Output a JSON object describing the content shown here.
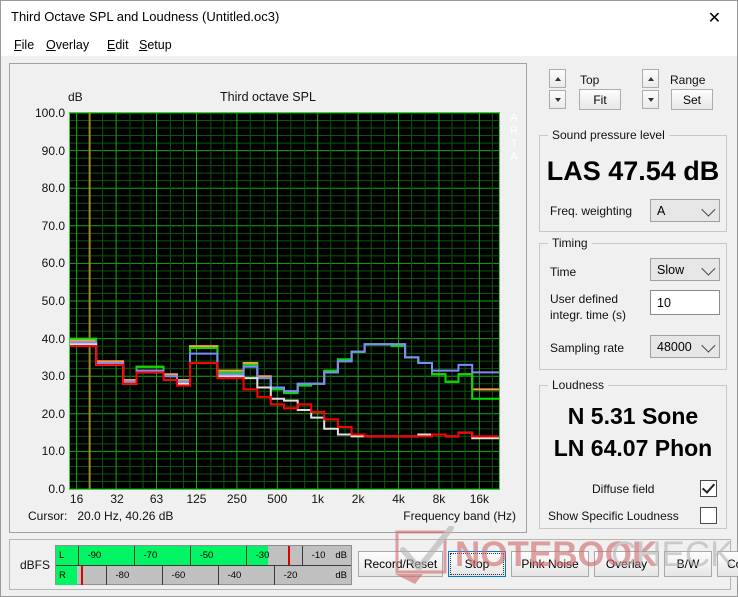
{
  "window": {
    "title": "Third Octave SPL and Loudness (Untitled.oc3)",
    "close_icon": "close-icon"
  },
  "menu": [
    {
      "label": "File",
      "accel": "F"
    },
    {
      "label": "Overlay",
      "accel": "O"
    },
    {
      "label": "Edit",
      "accel": "E"
    },
    {
      "label": "Setup",
      "accel": "S"
    }
  ],
  "chart_panel": {
    "title": "Third octave SPL",
    "y_unit": "dB",
    "watermark_vertical": "ARTA",
    "cursor_label": "Cursor:",
    "cursor_value": "20.0 Hz, 40.26 dB",
    "x_axis_title": "Frequency band (Hz)"
  },
  "toolbar": {
    "top_label": "Top",
    "top_button": "Fit",
    "range_label": "Range",
    "range_button": "Set"
  },
  "spl": {
    "group_title": "Sound pressure level",
    "value": "LAS 47.54 dB",
    "weighting_label": "Freq. weighting",
    "weighting_value": "A"
  },
  "timing": {
    "group_title": "Timing",
    "time_label": "Time",
    "time_value": "Slow",
    "integr_label_1": "User defined",
    "integr_label_2": "integr. time (s)",
    "integr_value": "10",
    "sampling_label": "Sampling rate",
    "sampling_value": "48000"
  },
  "loudness": {
    "group_title": "Loudness",
    "sone": "N 5.31 Sone",
    "phon": "LN 64.07 Phon",
    "diffuse_label": "Diffuse field",
    "diffuse_checked": true,
    "specific_label": "Show Specific Loudness",
    "specific_checked": false
  },
  "meter": {
    "label": "dBFS",
    "left_channel": "L",
    "right_channel": "R",
    "unit_left": "dB",
    "unit_right": "dB",
    "top_ticks": [
      "-90",
      "-70",
      "-50",
      "-30",
      "-10"
    ],
    "bottom_ticks": [
      "-80",
      "-60",
      "-40",
      "-20"
    ],
    "left_level_pct": 72,
    "right_level_pct": 7
  },
  "buttons": [
    {
      "label": "Record/Reset",
      "focused": false
    },
    {
      "label": "Stop",
      "focused": true
    },
    {
      "label": "Pink Noise",
      "focused": false
    },
    {
      "label": "Overlay",
      "focused": false
    },
    {
      "label": "B/W",
      "focused": false
    },
    {
      "label": "Copy",
      "focused": false
    }
  ],
  "watermark": {
    "text_red": "NOTEBOOK",
    "text_gray": "CHECK"
  },
  "colors": {
    "plot_bg": "#000000",
    "grid_major": "#19a519",
    "grid_minor": "#0d550d",
    "plot_border": "#39d339",
    "cursor_line": "#9a8a22",
    "curve_orange": "#ff9b45",
    "curve_green": "#00e000",
    "curve_blue": "#7a8cff",
    "curve_white": "#e0e0e0",
    "curve_red": "#ff0000",
    "meter_green": "#00f464",
    "brand_red": "#cf6b6b"
  },
  "chart_data": {
    "type": "line",
    "title": "Third octave SPL",
    "xlabel": "Frequency band (Hz)",
    "ylabel": "dB",
    "ylim": [
      0.0,
      100.0
    ],
    "ytick_labels": [
      "100.0",
      "90.0",
      "80.0",
      "70.0",
      "60.0",
      "50.0",
      "40.0",
      "30.0",
      "20.0",
      "10.0",
      "0.0"
    ],
    "ytick_values": [
      100,
      90,
      80,
      70,
      60,
      50,
      40,
      30,
      20,
      10,
      0
    ],
    "xtick_labels": [
      "16",
      "32",
      "63",
      "125",
      "250",
      "500",
      "1k",
      "2k",
      "4k",
      "8k",
      "16k"
    ],
    "xtick_values": [
      16,
      32,
      63,
      125,
      250,
      500,
      1000,
      2000,
      4000,
      8000,
      16000
    ],
    "grid": true,
    "legend": "none",
    "bands": [
      16,
      20,
      25,
      31.5,
      40,
      50,
      63,
      80,
      100,
      125,
      160,
      200,
      250,
      315,
      400,
      500,
      630,
      800,
      1000,
      1250,
      1600,
      2000,
      2500,
      3150,
      4000,
      5000,
      6300,
      8000,
      10000,
      12500,
      16000,
      20000
    ],
    "series": [
      {
        "name": "overlay-orange",
        "color": "#ff9b45",
        "values": [
          39.5,
          39.5,
          34.0,
          34.0,
          29.0,
          32.5,
          32.5,
          30.5,
          29.0,
          38.0,
          38.0,
          31.5,
          31.5,
          33.5,
          30.0,
          27.0,
          26.0,
          28.0,
          28.0,
          31.0,
          34.0,
          36.5,
          38.5,
          38.5,
          38.5,
          35.0,
          33.5,
          30.5,
          28.5,
          30.5,
          26.5,
          26.5
        ]
      },
      {
        "name": "overlay-green",
        "color": "#00e000",
        "values": [
          40.0,
          40.0,
          33.5,
          33.5,
          28.5,
          32.5,
          32.5,
          30.0,
          28.5,
          37.5,
          37.5,
          31.0,
          31.0,
          33.0,
          29.5,
          26.5,
          25.5,
          27.5,
          28.0,
          31.5,
          34.5,
          36.5,
          38.5,
          38.5,
          38.0,
          35.0,
          33.5,
          30.5,
          28.5,
          30.5,
          24.0,
          24.0
        ]
      },
      {
        "name": "overlay-blue",
        "color": "#7a8cff",
        "values": [
          39.0,
          39.0,
          33.5,
          33.5,
          28.5,
          31.5,
          31.5,
          30.0,
          28.5,
          36.0,
          36.0,
          30.5,
          30.5,
          32.5,
          29.5,
          27.0,
          26.0,
          28.0,
          28.0,
          31.0,
          34.0,
          36.5,
          38.5,
          38.5,
          38.5,
          35.0,
          33.5,
          31.5,
          31.5,
          33.0,
          31.0,
          31.0
        ]
      },
      {
        "name": "overlay-white",
        "color": "#e0e0e0",
        "values": [
          38.5,
          38.5,
          33.0,
          33.0,
          28.0,
          31.0,
          31.0,
          29.0,
          28.0,
          33.5,
          33.5,
          30.0,
          30.0,
          29.5,
          27.0,
          24.0,
          23.5,
          21.0,
          19.0,
          16.0,
          14.5,
          14.0,
          14.0,
          14.0,
          14.0,
          14.0,
          14.5,
          14.5,
          14.0,
          15.0,
          13.5,
          13.5
        ]
      },
      {
        "name": "current-red",
        "color": "#ff0000",
        "values": [
          38.0,
          38.0,
          33.0,
          33.0,
          28.0,
          31.0,
          31.0,
          29.0,
          27.5,
          33.5,
          33.5,
          29.5,
          29.5,
          26.5,
          24.5,
          22.5,
          21.5,
          22.5,
          20.5,
          18.5,
          16.5,
          14.5,
          14.0,
          14.0,
          14.0,
          14.0,
          14.0,
          14.5,
          14.0,
          15.0,
          14.0,
          14.0
        ]
      }
    ],
    "cursor": {
      "freq_hz": 20.0,
      "level_db": 40.26
    }
  }
}
